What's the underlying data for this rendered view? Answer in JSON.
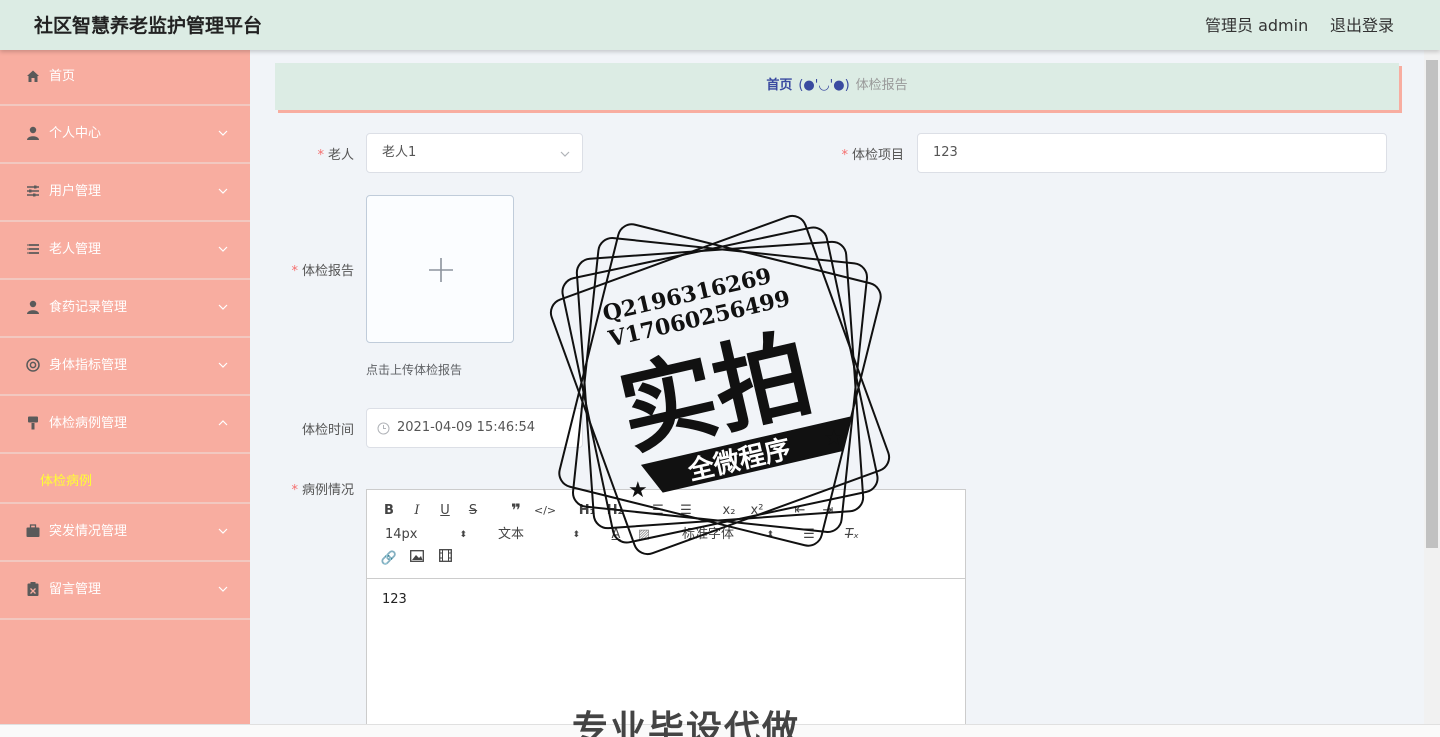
{
  "header": {
    "title": "社区智慧养老监护管理平台",
    "user": "管理员 admin",
    "logout": "退出登录"
  },
  "sidebar": {
    "items": [
      {
        "label": "首页",
        "icon": "home-icon"
      },
      {
        "label": "个人中心",
        "icon": "user-icon"
      },
      {
        "label": "用户管理",
        "icon": "sliders-icon"
      },
      {
        "label": "老人管理",
        "icon": "list-icon"
      },
      {
        "label": "食药记录管理",
        "icon": "user-icon"
      },
      {
        "label": "身体指标管理",
        "icon": "lifebuoy-icon"
      },
      {
        "label": "体检病例管理",
        "icon": "brush-icon"
      },
      {
        "label": "突发情况管理",
        "icon": "briefcase-icon"
      },
      {
        "label": "留言管理",
        "icon": "clipboard-icon"
      }
    ],
    "submenu": {
      "label": "体检病例"
    }
  },
  "breadcrumb": {
    "home": "首页",
    "separator": "(●'◡'●)",
    "current": "体检报告"
  },
  "form": {
    "elder_label": "老人",
    "elder_value": "老人1",
    "item_label": "体检项目",
    "item_value": "123",
    "report_label": "体检报告",
    "upload_tip": "点击上传体检报告",
    "time_label": "体检时间",
    "time_value": "2021-04-09 15:46:54",
    "case_label": "病例情况"
  },
  "editor": {
    "font_size": "14px",
    "paragraph": "文本",
    "font_family": "标准字体",
    "content": "123"
  },
  "watermark": {
    "qq": "Q2196316269",
    "wechat": "V17060256499",
    "big": "实拍",
    "banner": "全微程序",
    "bottom": "专业毕设代做"
  }
}
